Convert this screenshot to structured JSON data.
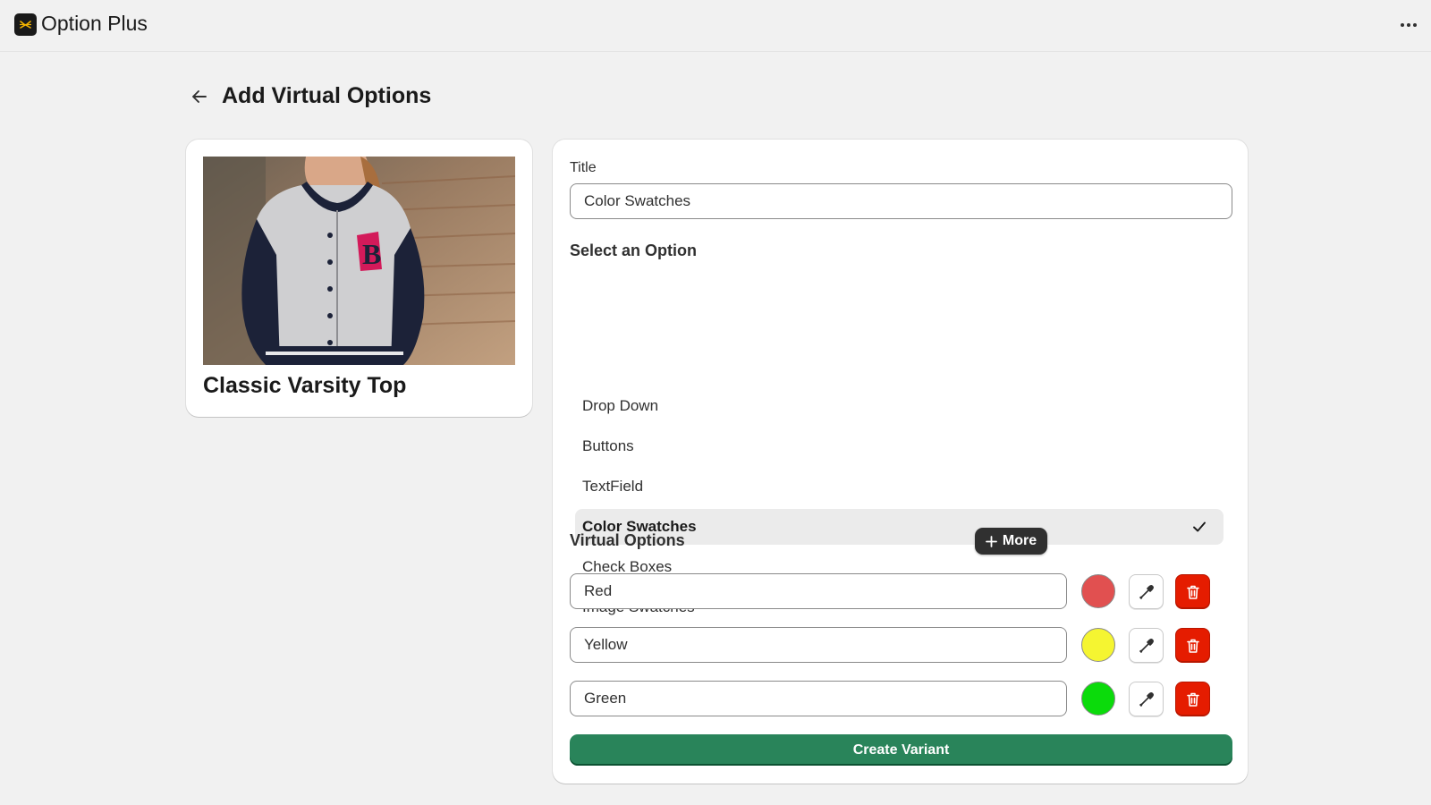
{
  "app": {
    "title": "Option Plus",
    "logo_icon": "option-plus-logo",
    "menu_icon": "ellipsis-icon"
  },
  "page": {
    "title": "Add Virtual Options",
    "back_icon": "arrow-left-icon"
  },
  "product": {
    "name": "Classic Varsity Top",
    "image_alt": "product-photo"
  },
  "form": {
    "title_label": "Title",
    "title_value": "Color Swatches",
    "select_label": "Select an Option",
    "options": [
      {
        "label": "Drop Down",
        "selected": false
      },
      {
        "label": "Buttons",
        "selected": false
      },
      {
        "label": "TextField",
        "selected": false
      },
      {
        "label": "Color Swatches",
        "selected": true
      },
      {
        "label": "Check Boxes",
        "selected": false
      },
      {
        "label": "Image Swatches",
        "selected": false
      }
    ],
    "virtual_options_label": "Virtual Options",
    "more_button_label": "More",
    "virtual_options": [
      {
        "value": "Red",
        "color": "#e15050"
      },
      {
        "value": "Yellow",
        "color": "#f5f531"
      },
      {
        "value": "Green",
        "color": "#0bdb0b"
      }
    ],
    "create_button_label": "Create Variant"
  },
  "colors": {
    "accent_green": "#29845a",
    "danger_red": "#e51c00",
    "background": "#f1f1f1"
  }
}
